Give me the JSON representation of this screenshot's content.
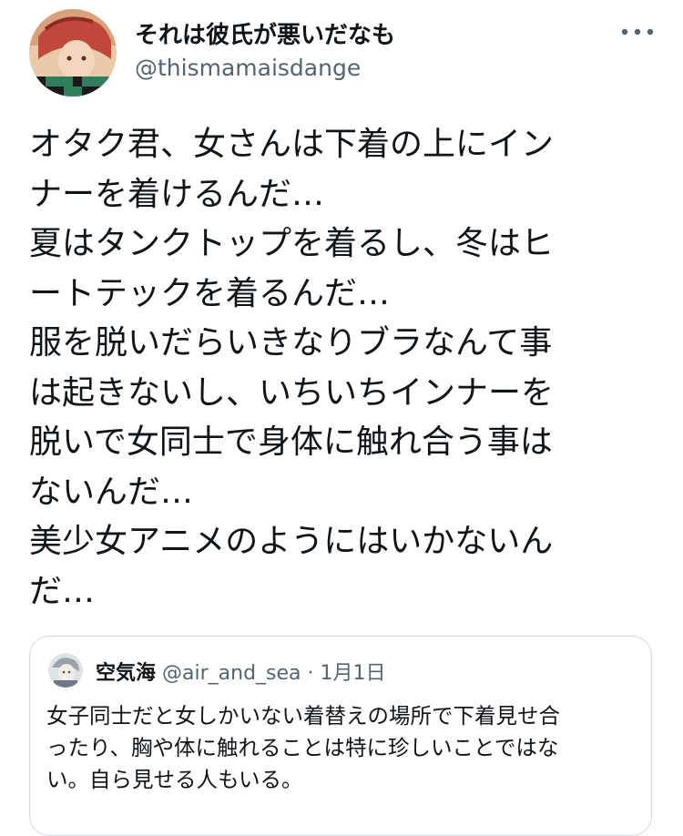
{
  "author": {
    "display_name": "それは彼氏が悪いだなも",
    "handle": "@thismamaisdange"
  },
  "more_icon": "more-dots-icon",
  "tweet": {
    "lines": [
      "オタク君、女さんは下着の上にイン",
      "ナーを着けるんだ…",
      "夏はタンクトップを着るし、冬はヒ",
      "ートテックを着るんだ…",
      "服を脱いだらいきなりブラなんて事",
      "は起きないし、いちいちインナーを",
      "脱いで女同士で身体に触れ合う事は",
      "ないんだ…",
      "美少女アニメのようにはいかないん",
      "だ…"
    ]
  },
  "quote": {
    "display_name": "空気海",
    "handle": "@air_and_sea",
    "separator": "·",
    "date": "1月1日",
    "lines": [
      "女子同士だと女しかいない着替えの場所で下着見せ合",
      "ったり、胸や体に触れることは特に珍しいことではな",
      "い。自ら見せる人もいる。"
    ]
  },
  "colors": {
    "text": "#0f1419",
    "secondary": "#536471",
    "border": "#cfd9de"
  }
}
